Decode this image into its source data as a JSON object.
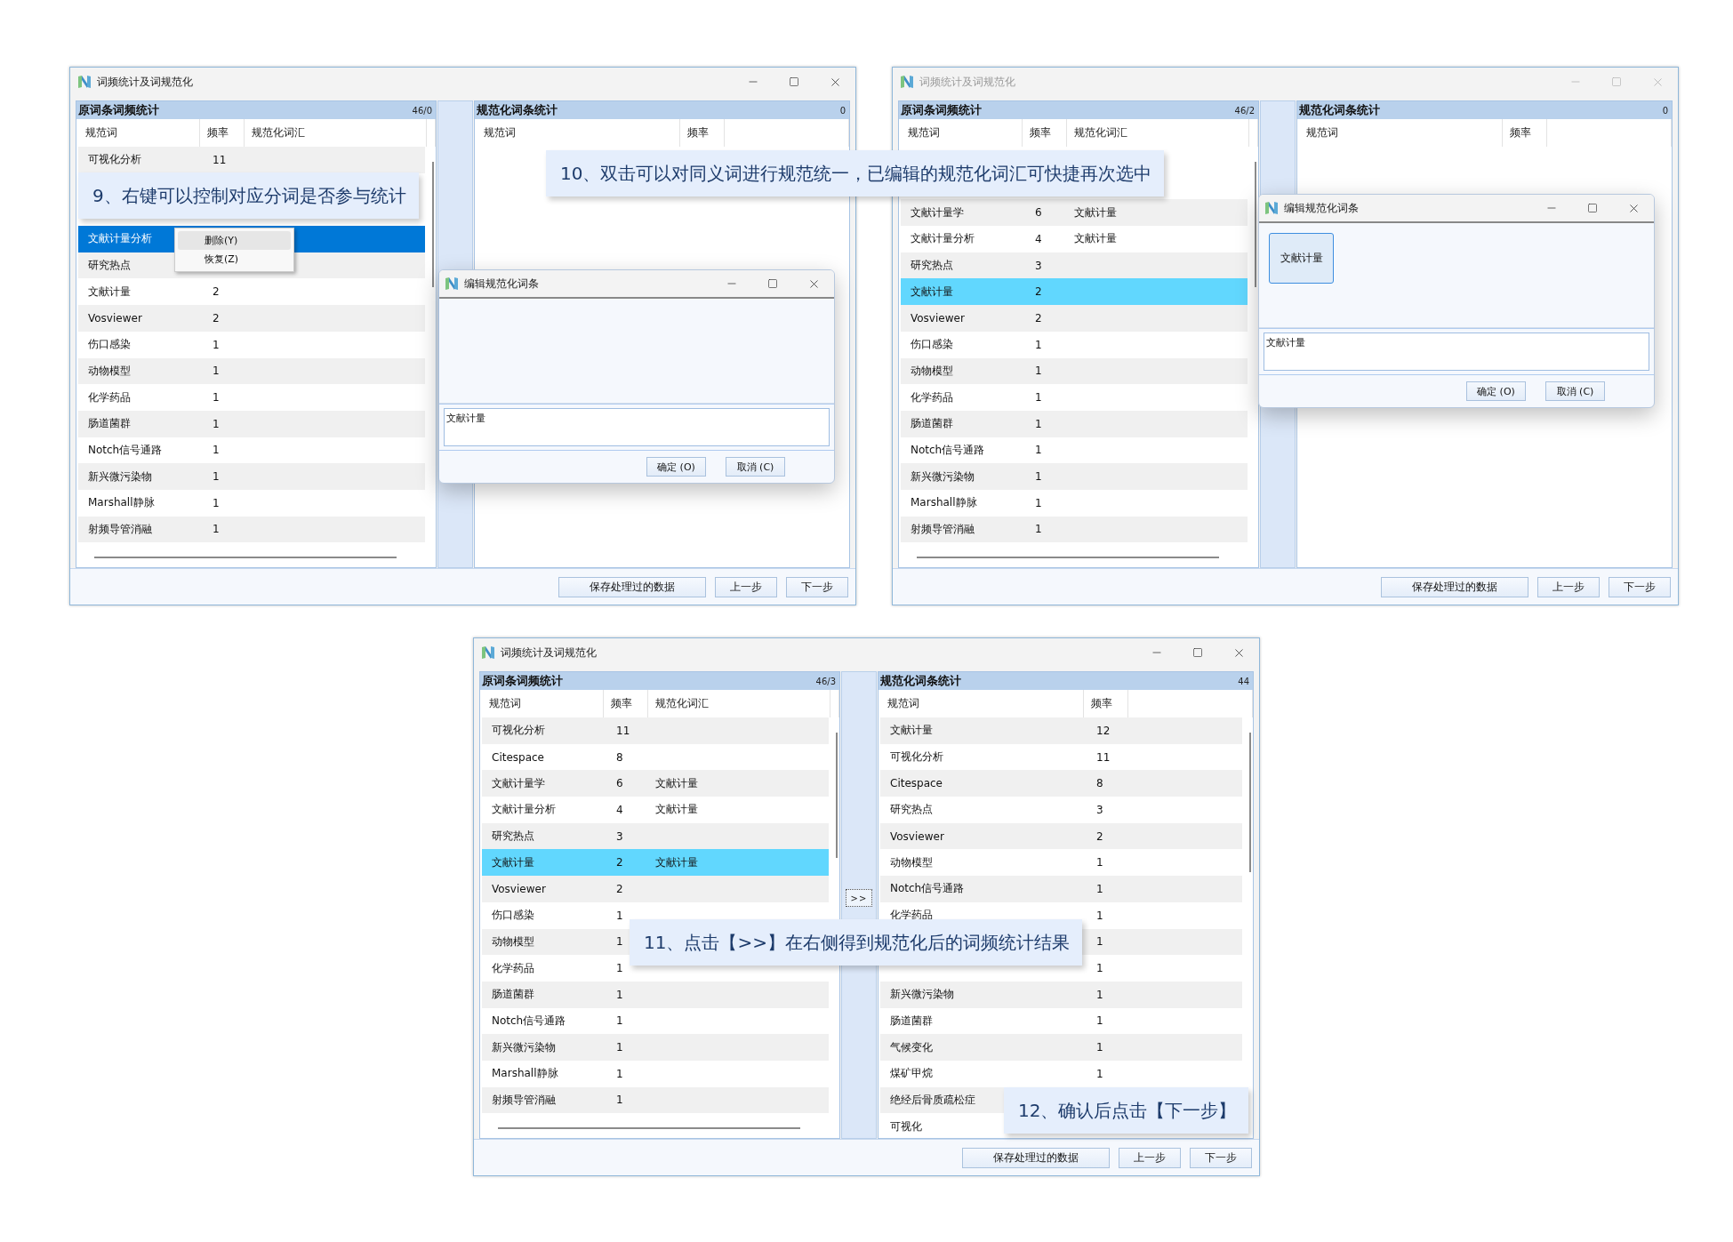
{
  "windows": [
    {
      "title": "词频统计及词规范化",
      "active": true,
      "left_panel": {
        "title": "原词条词频统计",
        "count": "46/0",
        "focused": true,
        "columns": [
          "规范词",
          "频率",
          "规范化词汇"
        ],
        "rows": [
          {
            "kind": "entry",
            "name": "可视化分析",
            "freq": "11",
            "selected": false
          },
          {
            "kind": "covered"
          },
          {
            "kind": "covered"
          },
          {
            "kind": "entry",
            "name": "文献计量分析",
            "selected": true
          },
          {
            "kind": "entry",
            "name": "研究热点",
            "selected": false
          },
          {
            "kind": "entry",
            "name": "文献计量",
            "freq": "2",
            "selected": false
          },
          {
            "kind": "entry",
            "name": "Vosviewer",
            "freq": "2",
            "selected": false
          },
          {
            "kind": "entry",
            "name": "伤口感染",
            "freq": "1",
            "selected": false
          },
          {
            "kind": "entry",
            "name": "动物模型",
            "freq": "1",
            "selected": false
          },
          {
            "kind": "entry",
            "name": "化学药品",
            "freq": "1",
            "selected": false
          },
          {
            "kind": "entry",
            "name": "肠道菌群",
            "freq": "1",
            "selected": false
          },
          {
            "kind": "entry",
            "name": "Notch信号通路",
            "freq": "1",
            "selected": false
          },
          {
            "kind": "entry",
            "name": "新兴微污染物",
            "freq": "1",
            "selected": false
          },
          {
            "kind": "entry",
            "name": "Marshall静脉",
            "freq": "1",
            "selected": false
          },
          {
            "kind": "entry",
            "name": "射频导管消融",
            "freq": "1",
            "selected": false
          }
        ]
      },
      "right_panel": {
        "title": "规范化词条统计",
        "count": "0",
        "columns": [
          "规范词",
          "频率"
        ]
      },
      "context_menu": [
        {
          "label": "删除(Y)",
          "selected": true
        },
        {
          "label": "恢复(Z)",
          "selected": false
        }
      ],
      "dialog": {
        "title": "编辑规范化词条",
        "value": "文献计量",
        "buttons": [
          "确定 (O)",
          "取消 (C)"
        ]
      },
      "buttons": [
        "保存处理过的数据",
        "上一步",
        "下一步"
      ]
    },
    {
      "title": "词频统计及词规范化",
      "active": false,
      "left_panel": {
        "title": "原词条词频统计",
        "count": "46/2",
        "focused": false,
        "columns": [
          "规范词",
          "频率",
          "规范化词汇"
        ],
        "rows": [
          {
            "kind": "covered"
          },
          {
            "kind": "covered"
          },
          {
            "kind": "entry",
            "name": "文献计量学",
            "freq": "6",
            "norm": "文献计量",
            "selected": false
          },
          {
            "kind": "entry",
            "name": "文献计量分析",
            "freq": "4",
            "norm": "文献计量",
            "selected": false
          },
          {
            "kind": "entry",
            "name": "研究热点",
            "freq": "3",
            "selected": false
          },
          {
            "kind": "entry",
            "name": "文献计量",
            "freq": "2",
            "selected": true
          },
          {
            "kind": "entry",
            "name": "Vosviewer",
            "freq": "2",
            "selected": false
          },
          {
            "kind": "entry",
            "name": "伤口感染",
            "freq": "1",
            "selected": false
          },
          {
            "kind": "entry",
            "name": "动物模型",
            "freq": "1",
            "selected": false
          },
          {
            "kind": "entry",
            "name": "化学药品",
            "freq": "1",
            "selected": false
          },
          {
            "kind": "entry",
            "name": "肠道菌群",
            "freq": "1",
            "selected": false
          },
          {
            "kind": "entry",
            "name": "Notch信号通路",
            "freq": "1",
            "selected": false
          },
          {
            "kind": "entry",
            "name": "新兴微污染物",
            "freq": "1",
            "selected": false
          },
          {
            "kind": "entry",
            "name": "Marshall静脉",
            "freq": "1",
            "selected": false
          },
          {
            "kind": "entry",
            "name": "射频导管消融",
            "freq": "1",
            "selected": false
          }
        ]
      },
      "right_panel": {
        "title": "规范化词条统计",
        "count": "0",
        "columns": [
          "规范词",
          "频率"
        ]
      },
      "dialog": {
        "title": "编辑规范化词条",
        "chips": [
          "文献计量"
        ],
        "value": "文献计量",
        "buttons": [
          "确定 (O)",
          "取消 (C)"
        ]
      },
      "buttons": [
        "保存处理过的数据",
        "上一步",
        "下一步"
      ]
    },
    {
      "title": "词频统计及词规范化",
      "active": true,
      "left_panel": {
        "title": "原词条词频统计",
        "count": "46/3",
        "focused": false,
        "columns": [
          "规范词",
          "频率",
          "规范化词汇"
        ],
        "rows": [
          {
            "kind": "entry",
            "name": "可视化分析",
            "freq": "11",
            "selected": false
          },
          {
            "kind": "entry",
            "name": "Citespace",
            "freq": "8",
            "selected": false
          },
          {
            "kind": "entry",
            "name": "文献计量学",
            "freq": "6",
            "norm": "文献计量",
            "selected": false
          },
          {
            "kind": "entry",
            "name": "文献计量分析",
            "freq": "4",
            "norm": "文献计量",
            "selected": false
          },
          {
            "kind": "entry",
            "name": "研究热点",
            "freq": "3",
            "selected": false
          },
          {
            "kind": "entry",
            "name": "文献计量",
            "freq": "2",
            "norm": "文献计量",
            "selected": true
          },
          {
            "kind": "entry",
            "name": "Vosviewer",
            "freq": "2",
            "selected": false
          },
          {
            "kind": "entry",
            "name": "伤口感染",
            "freq": "1",
            "selected": false
          },
          {
            "kind": "entry",
            "name": "动物模型",
            "freq": "1",
            "selected": false
          },
          {
            "kind": "entry",
            "name": "化学药品",
            "freq": "1",
            "selected": false
          },
          {
            "kind": "entry",
            "name": "肠道菌群",
            "freq": "1",
            "selected": false
          },
          {
            "kind": "entry",
            "name": "Notch信号通路",
            "freq": "1",
            "selected": false
          },
          {
            "kind": "entry",
            "name": "新兴微污染物",
            "freq": "1",
            "selected": false
          },
          {
            "kind": "entry",
            "name": "Marshall静脉",
            "freq": "1",
            "selected": false
          },
          {
            "kind": "entry",
            "name": "射频导管消融",
            "freq": "1",
            "selected": false
          }
        ]
      },
      "transfer_button": ">>",
      "right_panel": {
        "title": "规范化词条统计",
        "count": "44",
        "columns": [
          "规范词",
          "频率"
        ],
        "rows": [
          {
            "kind": "entry",
            "name": "文献计量",
            "freq": "12",
            "selected": false
          },
          {
            "kind": "entry",
            "name": "可视化分析",
            "freq": "11",
            "selected": false
          },
          {
            "kind": "entry",
            "name": "Citespace",
            "freq": "8",
            "selected": false
          },
          {
            "kind": "entry",
            "name": "研究热点",
            "freq": "3",
            "selected": false
          },
          {
            "kind": "entry",
            "name": "Vosviewer",
            "freq": "2",
            "selected": false
          },
          {
            "kind": "entry",
            "name": "动物模型",
            "freq": "1",
            "selected": false
          },
          {
            "kind": "entry",
            "name": "Notch信号通路",
            "freq": "1",
            "selected": false
          },
          {
            "kind": "entry",
            "name": "化学药品",
            "freq": "1",
            "selected": false
          },
          {
            "kind": "entry",
            "freq": "1",
            "selected": false
          },
          {
            "kind": "entry",
            "freq": "1",
            "selected": false
          },
          {
            "kind": "entry",
            "name": "新兴微污染物",
            "freq": "1",
            "selected": false
          },
          {
            "kind": "entry",
            "name": "肠道菌群",
            "freq": "1",
            "selected": false
          },
          {
            "kind": "entry",
            "name": "气候变化",
            "freq": "1",
            "selected": false
          },
          {
            "kind": "entry",
            "name": "煤矿甲烷",
            "freq": "1",
            "selected": false
          },
          {
            "kind": "entry",
            "name": "绝经后骨质疏松症",
            "selected": false
          },
          {
            "kind": "entry",
            "name": "可视化",
            "selected": false
          }
        ]
      },
      "buttons": [
        "保存处理过的数据",
        "上一步",
        "下一步"
      ]
    }
  ],
  "callouts": [
    {
      "text": "9、右键可以控制对应分词是否参与统计"
    },
    {
      "text": "10、双击可以对同义词进行规范统一，已编辑的规范化词汇可快捷再次选中"
    },
    {
      "text": "11、点击【>>】在右侧得到规范化后的词频统计结果"
    },
    {
      "text": "12、确认后点击【下一步】"
    }
  ]
}
